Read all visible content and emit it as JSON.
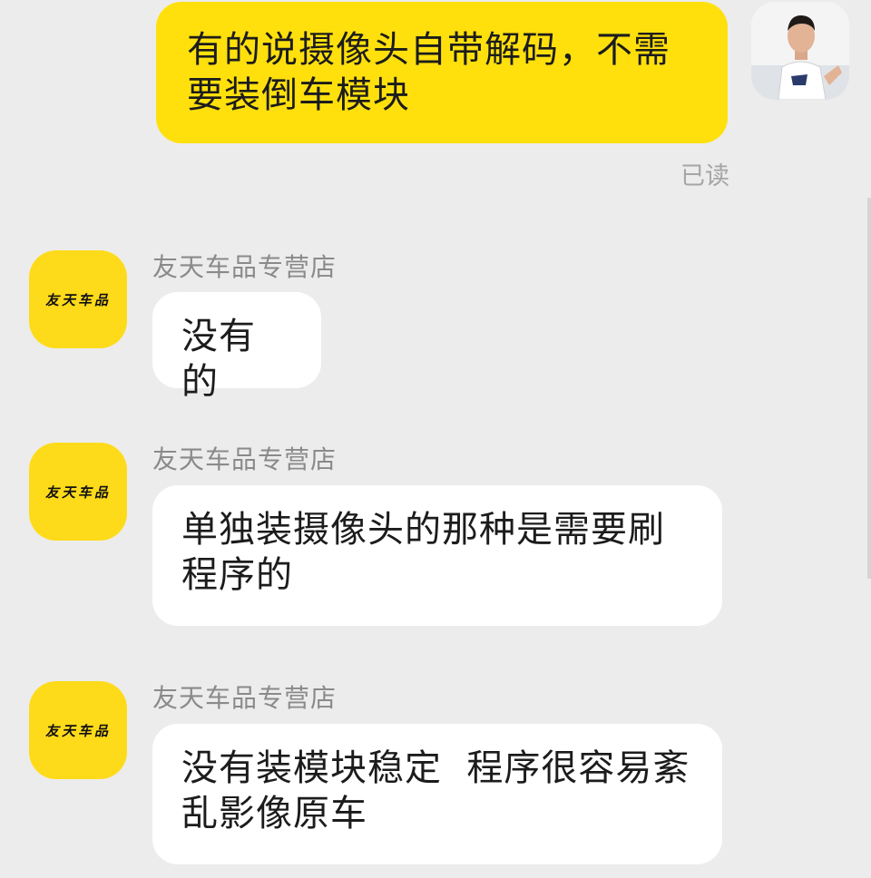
{
  "outgoing": {
    "text": "有的说摄像头自带解码，不需要装倒车模块",
    "status": "已读"
  },
  "incoming": [
    {
      "sender": "友天车品专营店",
      "avatar_text": "友天车品",
      "text": "没有的"
    },
    {
      "sender": "友天车品专营店",
      "avatar_text": "友天车品",
      "text": "单独装摄像头的那种是需要刷程序的"
    },
    {
      "sender": "友天车品专营店",
      "avatar_text": "友天车品",
      "text": "没有装模块稳定  程序很容易紊乱影像原车"
    }
  ],
  "colors": {
    "background": "#ececec",
    "outgoing_bubble": "#ffe00d",
    "incoming_bubble": "#ffffff",
    "shop_avatar": "#fedb1a",
    "sender_name": "#8a8a8a",
    "read_status": "#a5a5a5"
  }
}
